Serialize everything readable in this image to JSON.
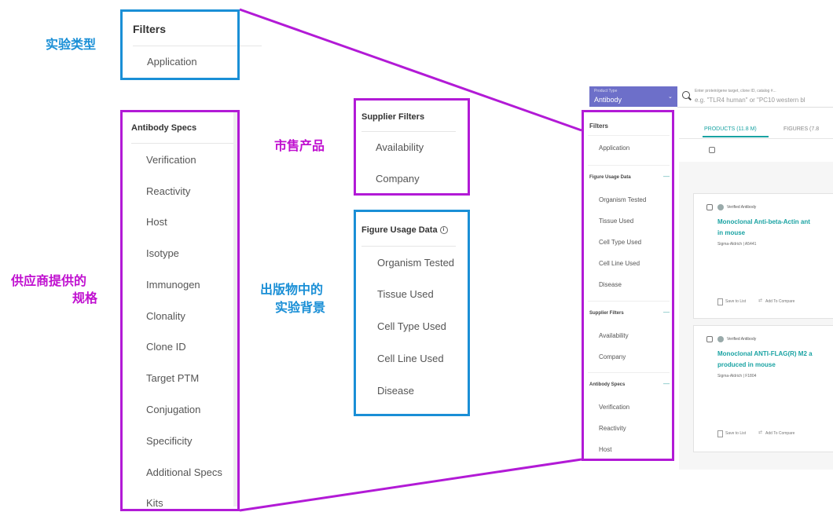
{
  "annotations": {
    "experiment_type": "实验类型",
    "market_products": "市售产品",
    "supplier_specs": "供应商提供的\n规格",
    "supplier_specs_line1": "供应商提供的",
    "supplier_specs_line2": "规格",
    "publication_context": "出版物中的\n实验背景",
    "publication_context_line1": "出版物中的",
    "publication_context_line2": "实验背景"
  },
  "colors": {
    "blue": "#1a8fd6",
    "pink": "#b21ad6",
    "accent_teal": "#1aa3a3",
    "header_purple": "#6d6fc9"
  },
  "filters_panel": {
    "title": "Filters",
    "items": [
      "Application"
    ]
  },
  "antibody_specs_panel": {
    "title": "Antibody Specs",
    "items": [
      "Verification",
      "Reactivity",
      "Host",
      "Isotype",
      "Immunogen",
      "Clonality",
      "Clone ID",
      "Target PTM",
      "Conjugation",
      "Specificity",
      "Additional Specs",
      "Kits"
    ]
  },
  "supplier_filters_panel": {
    "title": "Supplier Filters",
    "items": [
      "Availability",
      "Company"
    ]
  },
  "figure_usage_panel": {
    "title": "Figure Usage Data",
    "info_icon": "info-icon",
    "items": [
      "Organism Tested",
      "Tissue Used",
      "Cell Type Used",
      "Cell Line Used",
      "Disease"
    ]
  },
  "mini_app": {
    "product_type_label": "Product Type",
    "product_type_value": "Antibody",
    "search_hint": "Enter protein/gene target, clone ID, catalog #...",
    "search_placeholder": "e.g. \"TLR4 human\" or \"PC10 western bl",
    "tabs": [
      "PRODUCTS (11.8 M)",
      "FIGURES (7.8"
    ],
    "sidebar": {
      "filters_title": "Filters",
      "application": "Application",
      "figure_usage_title": "Figure Usage Data",
      "figure_usage_items": [
        "Organism Tested",
        "Tissue Used",
        "Cell Type Used",
        "Cell Line Used",
        "Disease"
      ],
      "supplier_filters_title": "Supplier Filters",
      "supplier_items": [
        "Availability",
        "Company"
      ],
      "antibody_specs_title": "Antibody Specs",
      "antibody_items": [
        "Verification",
        "Reactivity",
        "Host"
      ],
      "minus": "—"
    },
    "cards": [
      {
        "badge": "Verified Antibody",
        "title_line1": "Monoclonal Anti-beta-Actin ant",
        "title_line2": "in mouse",
        "meta": "Sigma-Aldrich | A5441",
        "save": "Save to List",
        "compare": "Add To Compare"
      },
      {
        "badge": "Verified Antibody",
        "title_line1": "Monoclonal ANTI-FLAG(R) M2 a",
        "title_line2": "produced in mouse",
        "meta": "Sigma-Aldrich | F1804",
        "save": "Save to List",
        "compare": "Add To Compare"
      }
    ]
  }
}
